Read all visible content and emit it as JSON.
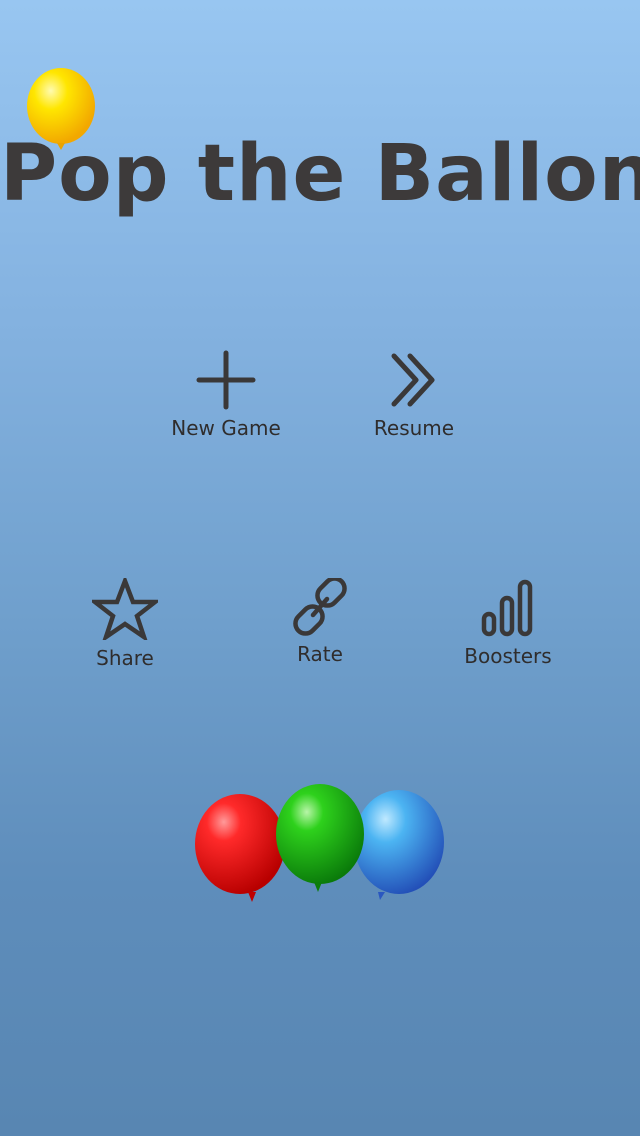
{
  "title": "Pop the Ballon",
  "menu": {
    "new_game": {
      "label": "New Game",
      "icon": "plus-icon"
    },
    "resume": {
      "label": "Resume",
      "icon": "double-chevron-right-icon"
    },
    "share": {
      "label": "Share",
      "icon": "star-icon"
    },
    "rate": {
      "label": "Rate",
      "icon": "link-icon"
    },
    "boosters": {
      "label": "Boosters",
      "icon": "signal-bars-icon"
    }
  },
  "colors": {
    "background_top": "#98c6f1",
    "background_bottom": "#5886b2",
    "text": "#3d3a3a",
    "balloon_yellow": "#ffd400",
    "balloon_red": "#e8151b",
    "balloon_green": "#17ad12",
    "balloon_blue": "#3f9ee8"
  }
}
